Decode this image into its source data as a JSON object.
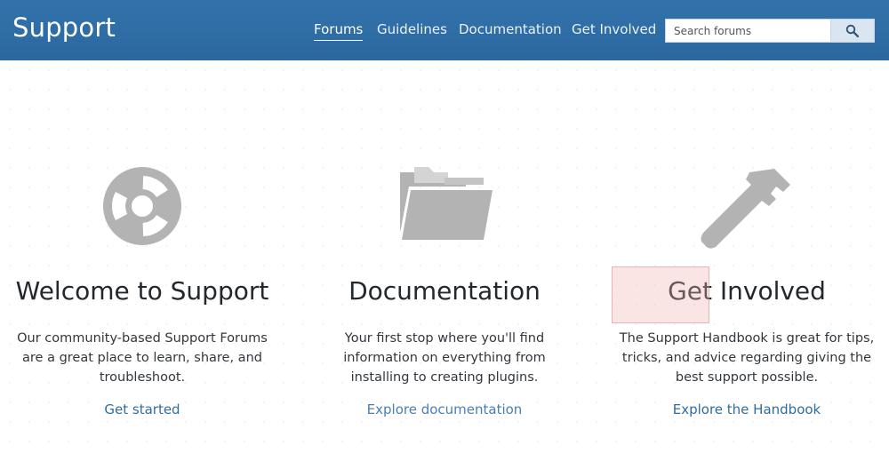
{
  "header": {
    "brand": "Support",
    "nav": [
      {
        "label": "Forums",
        "active": true
      },
      {
        "label": "Guidelines",
        "active": false
      },
      {
        "label": "Documentation",
        "active": false
      },
      {
        "label": "Get Involved",
        "active": false
      }
    ],
    "search": {
      "placeholder": "Search forums",
      "button_icon": "search-icon"
    }
  },
  "colors": {
    "header_bg": "#2e6da4",
    "icon_gray": "#b3b3b3",
    "link": "#2e6da4"
  },
  "columns": [
    {
      "icon": "lifebuoy-icon",
      "title": "Welcome to Support",
      "description": "Our community-based Support Forums are a great place to learn, share, and troubleshoot.",
      "link": "Get started"
    },
    {
      "icon": "folder-icon",
      "title": "Documentation",
      "description": "Your first stop where you'll find information on everything from installing to creating plugins.",
      "link": "Explore documentation"
    },
    {
      "icon": "hammer-icon",
      "title": "Get Involved",
      "description": "The Support Handbook is great for tips, tricks, and advice regarding giving the best support possible.",
      "link": "Explore the Handbook"
    }
  ]
}
